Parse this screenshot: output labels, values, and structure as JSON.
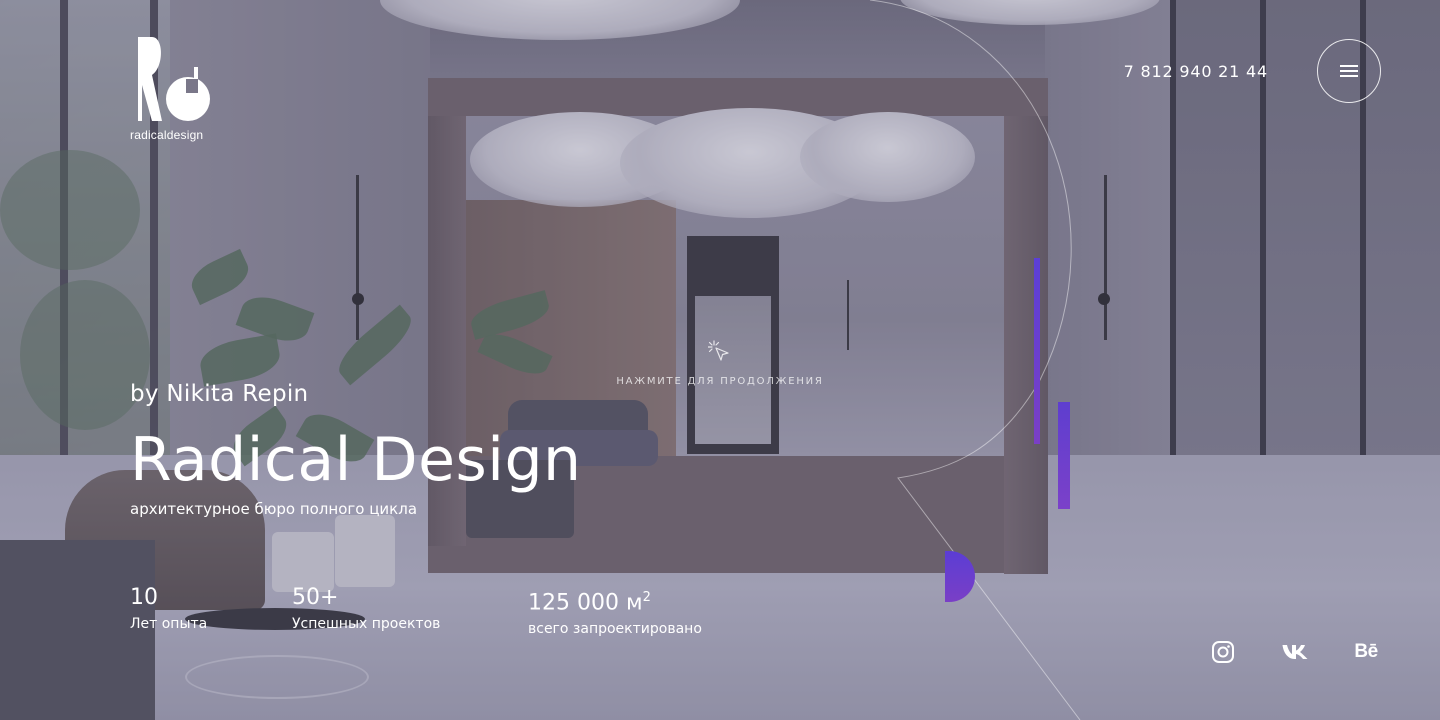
{
  "brand": {
    "logo_text": "radicaldesign"
  },
  "header": {
    "phone": "7 812 940 21 44",
    "menu_icon": "hamburger-icon"
  },
  "hint": {
    "icon": "cursor-click-icon",
    "text": "НАЖМИТЕ ДЛЯ ПРОДОЛЖЕНИЯ"
  },
  "hero": {
    "byline": "by Nikita Repin",
    "title": "Radical Design",
    "subtitle": "архитектурное бюро полного цикла"
  },
  "stats": [
    {
      "value": "10",
      "label": "Лет опыта"
    },
    {
      "value": "50+",
      "label": "Успешных проектов"
    },
    {
      "value": "125 000 м",
      "unit_sup": "2",
      "label": "всего запроектировано"
    }
  ],
  "social": [
    {
      "icon": "instagram-icon"
    },
    {
      "icon": "vk-icon"
    },
    {
      "icon": "behance-icon",
      "glyph": "Bē"
    }
  ],
  "colors": {
    "accent_start": "#5b3dd4",
    "accent_end": "#7a3fc6",
    "text": "#ffffff",
    "overlay": "#69648a"
  }
}
